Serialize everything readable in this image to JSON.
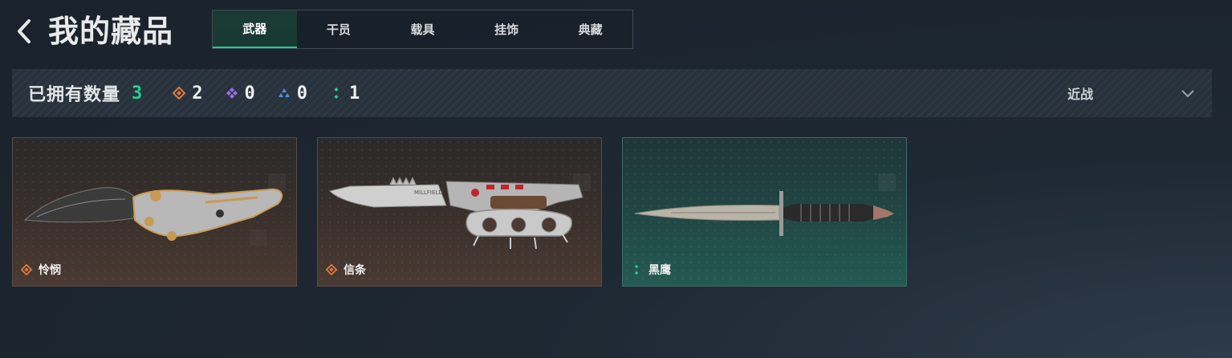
{
  "header": {
    "title": "我的藏品",
    "back_icon": "chevron-left-icon"
  },
  "tabs": [
    {
      "label": "武器",
      "active": true
    },
    {
      "label": "干员",
      "active": false
    },
    {
      "label": "载具",
      "active": false
    },
    {
      "label": "挂饰",
      "active": false
    },
    {
      "label": "典藏",
      "active": false
    }
  ],
  "stats": {
    "owned_label": "已拥有数量",
    "owned_count": "3",
    "rarity_counts": [
      {
        "icon": "orange-diamond-icon",
        "color": "#e07a3c",
        "value": "2"
      },
      {
        "icon": "purple-diamond-cluster-icon",
        "color": "#9b6cf0",
        "value": "0"
      },
      {
        "icon": "blue-triangle-cluster-icon",
        "color": "#4a90d9",
        "value": "0"
      },
      {
        "icon": "green-dots-icon",
        "color": "#2ad08f",
        "value": "1"
      }
    ],
    "filter": {
      "selected": "近战",
      "icon": "chevron-down-icon"
    }
  },
  "items": [
    {
      "name": "怜悯",
      "rarity_icon": "orange-diamond-icon",
      "rarity_color": "#e07a3c",
      "image": "folding-knife-icon"
    },
    {
      "name": "信条",
      "rarity_icon": "orange-diamond-icon",
      "rarity_color": "#e07a3c",
      "image": "knuckle-knife-icon"
    },
    {
      "name": "黑鹰",
      "rarity_icon": "green-dots-icon",
      "rarity_color": "#2ad08f",
      "image": "dagger-icon"
    }
  ],
  "colors": {
    "accent_green": "#27d08f",
    "card_gold_border": "#5a4b42",
    "card_green_border": "#3f6b6a"
  }
}
